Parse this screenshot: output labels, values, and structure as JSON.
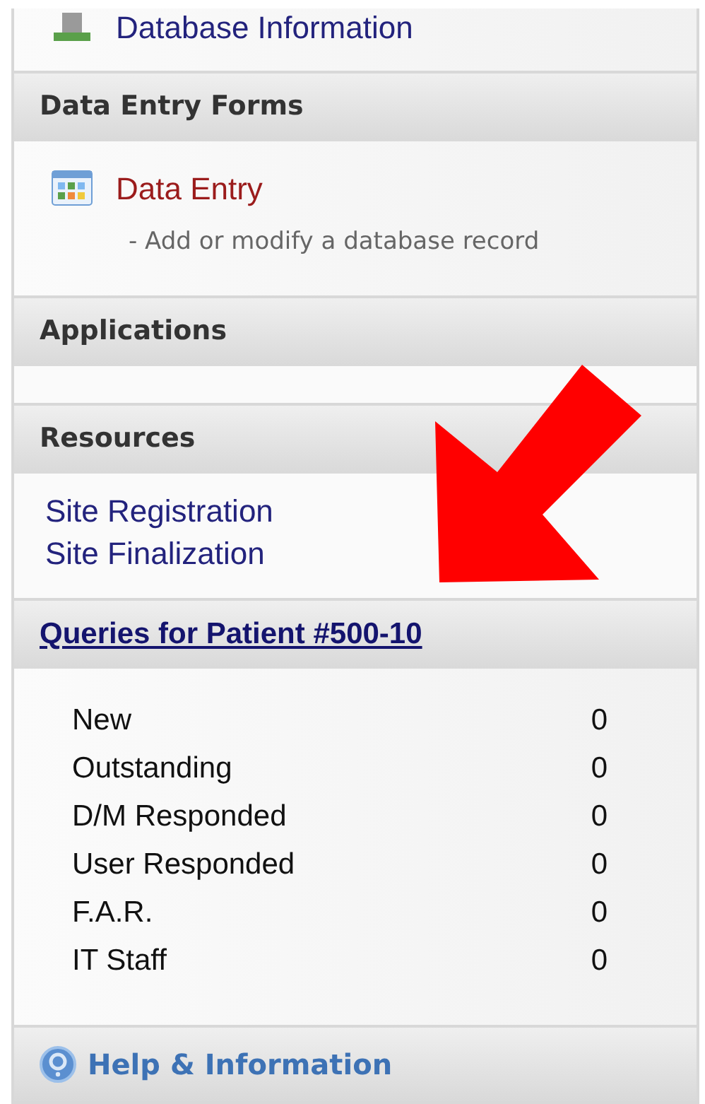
{
  "sections": [
    {
      "kind": "links",
      "items": [
        {
          "kind": "database-link",
          "label": "Database Information"
        }
      ]
    },
    {
      "kind": "links",
      "title": "Data Entry Forms",
      "items": [
        {
          "kind": "form-link",
          "label": "Data Entry",
          "description": "- Add or modify a database record"
        }
      ]
    },
    {
      "kind": "empty",
      "title": "Applications"
    },
    {
      "kind": "plain-links",
      "title": "Resources",
      "items": [
        {
          "label": "Site Registration"
        },
        {
          "label": "Site Finalization"
        }
      ]
    },
    {
      "kind": "counts",
      "title": "Queries for Patient #500-10",
      "rows": [
        {
          "label": "New",
          "count": "0"
        },
        {
          "label": "Outstanding",
          "count": "0"
        },
        {
          "label": "D/M Responded",
          "count": "0"
        },
        {
          "label": "User Responded",
          "count": "0"
        },
        {
          "label": "F.A.R.",
          "count": "0"
        },
        {
          "label": "IT Staff",
          "count": "0"
        }
      ]
    },
    {
      "kind": "help",
      "title": "Help & Information"
    }
  ],
  "annotation": {
    "kind": "arrow"
  }
}
